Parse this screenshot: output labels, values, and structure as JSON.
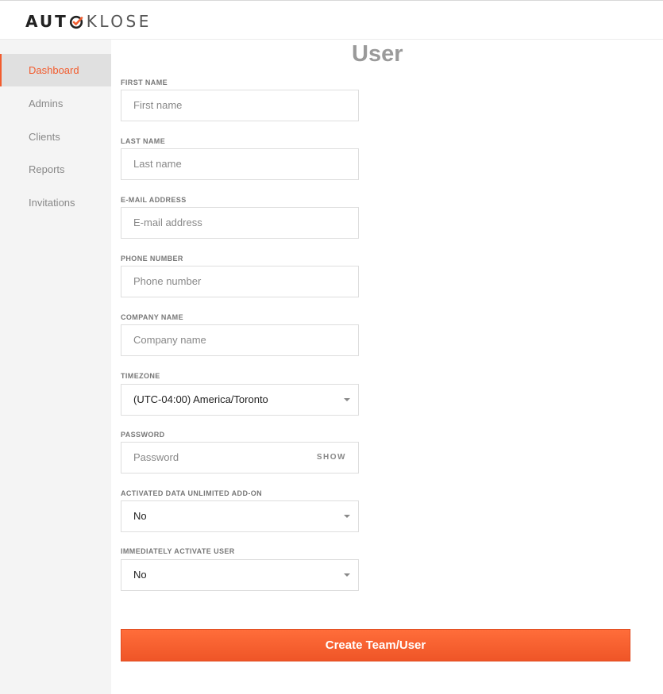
{
  "brand": {
    "part1": "AUT",
    "part2": "KLOSE",
    "accent": "#f25c2e"
  },
  "sidebar": {
    "items": [
      {
        "label": "Dashboard",
        "active": true
      },
      {
        "label": "Admins"
      },
      {
        "label": "Clients"
      },
      {
        "label": "Reports"
      },
      {
        "label": "Invitations"
      }
    ]
  },
  "page": {
    "title": "User"
  },
  "form": {
    "first_name": {
      "label": "FIRST NAME",
      "placeholder": "First name"
    },
    "last_name": {
      "label": "LAST NAME",
      "placeholder": "Last name"
    },
    "email": {
      "label": "E-MAIL ADDRESS",
      "placeholder": "E-mail address"
    },
    "phone": {
      "label": "PHONE NUMBER",
      "placeholder": "Phone number"
    },
    "company": {
      "label": "COMPANY NAME",
      "placeholder": "Company name"
    },
    "timezone": {
      "label": "TIMEZONE",
      "value": "(UTC-04:00) America/Toronto"
    },
    "password": {
      "label": "PASSWORD",
      "placeholder": "Password",
      "show_label": "SHOW"
    },
    "data_addon": {
      "label": "ACTIVATED DATA UNLIMITED ADD-ON",
      "value": "No"
    },
    "activate_user": {
      "label": "IMMEDIATELY ACTIVATE USER",
      "value": "No"
    }
  },
  "actions": {
    "create_label": "Create Team/User"
  }
}
